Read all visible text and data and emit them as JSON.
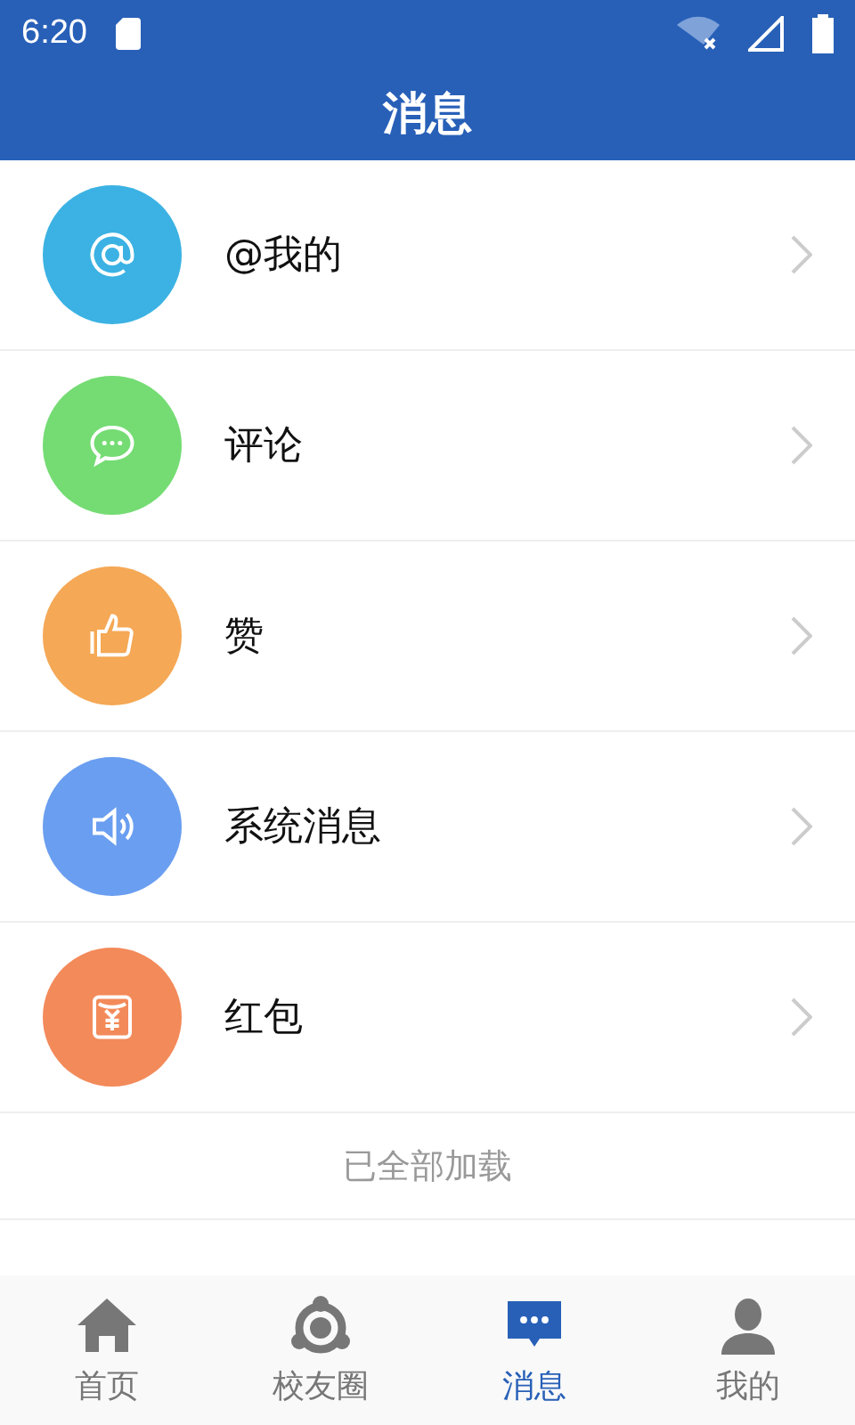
{
  "status_bar": {
    "time": "6:20"
  },
  "header": {
    "title": "消息"
  },
  "items": [
    {
      "label": "@我的",
      "kind": "at",
      "color": "#3bb2e3"
    },
    {
      "label": "评论",
      "kind": "chat",
      "color": "#74dc73"
    },
    {
      "label": "赞",
      "kind": "thumb",
      "color": "#f5a855"
    },
    {
      "label": "系统消息",
      "kind": "speaker",
      "color": "#6a9ef0"
    },
    {
      "label": "红包",
      "kind": "packet",
      "color": "#f38a5a"
    }
  ],
  "footer_note": "已全部加载",
  "tabs": [
    {
      "label": "首页",
      "kind": "home",
      "selected": false
    },
    {
      "label": "校友圈",
      "kind": "circle",
      "selected": false
    },
    {
      "label": "消息",
      "kind": "message",
      "selected": true
    },
    {
      "label": "我的",
      "kind": "person",
      "selected": false
    }
  ]
}
